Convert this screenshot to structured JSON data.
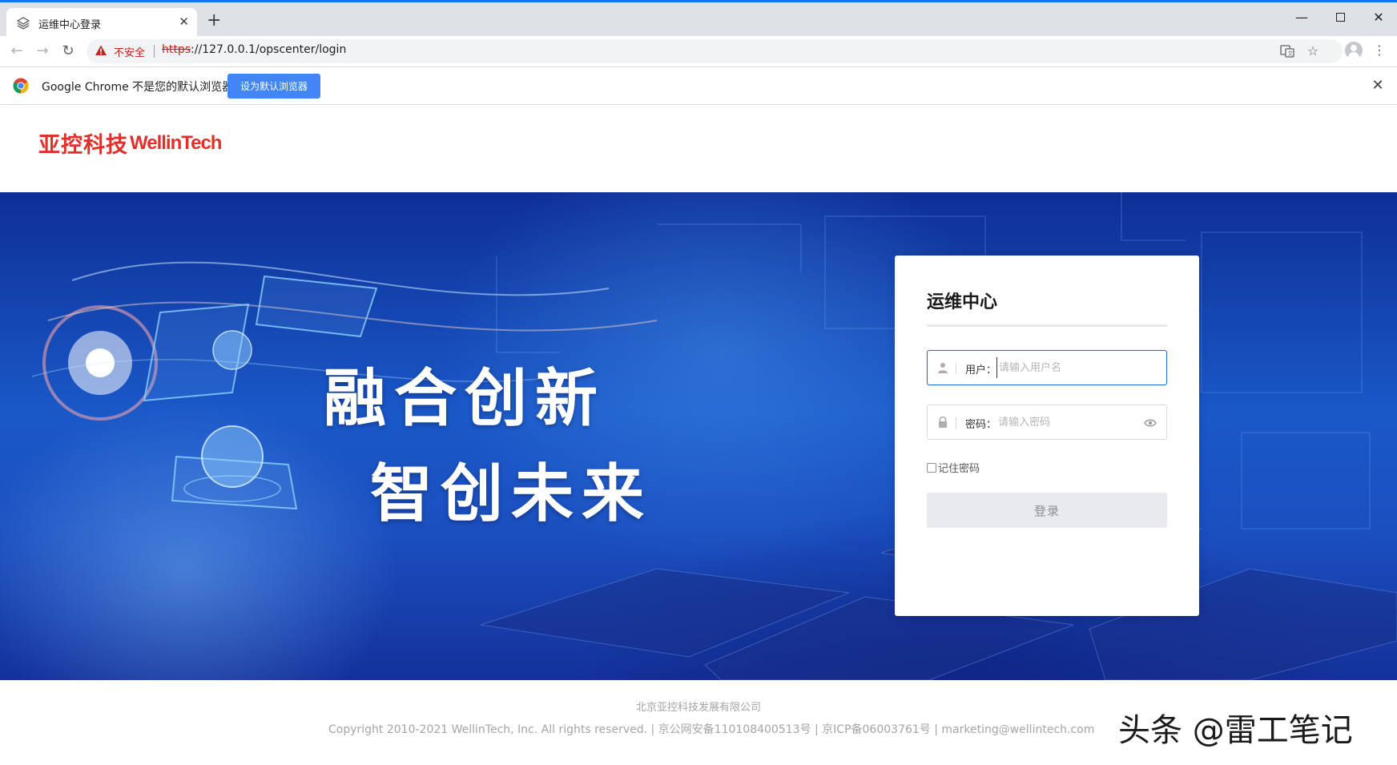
{
  "browser": {
    "tab_title": "运维中心登录",
    "tab_close": "✕",
    "new_tab": "+",
    "window_controls": {
      "minimize": "—",
      "close": "✕"
    },
    "security_label": "不安全",
    "url_scheme": "https",
    "url_rest": "://127.0.0.1/opscenter/login",
    "infobar_text": "Google Chrome 不是您的默认浏览器",
    "infobar_button": "设为默认浏览器",
    "infobar_close": "✕",
    "icons": [
      "layers-icon",
      "back-arrow-icon",
      "forward-arrow-icon",
      "reload-icon",
      "warning-icon",
      "translate-icon",
      "star-icon",
      "profile-icon",
      "menu-icon",
      "chrome-logo-icon"
    ]
  },
  "header": {
    "logo_cn": "亚控科技",
    "logo_en": "WellinTech",
    "logo_color": "#e22f2a"
  },
  "banner": {
    "slogan_line1": "融合创新",
    "slogan_line2": "智创未来"
  },
  "login": {
    "title": "运维中心",
    "username_label": "用户：",
    "username_placeholder": "请输入用户名",
    "password_label": "密码：",
    "password_placeholder": "请输入密码",
    "remember_label": "记住密码",
    "remember_checked": false,
    "submit_label": "登录",
    "accent_color": "#1e6fd9"
  },
  "footer": {
    "company": "北京亚控科技发展有限公司",
    "copyright": "Copyright 2010-2021 WellinTech, Inc. All rights reserved. | 京公网安备110108400513号 | 京ICP备06003761号 | marketing@wellintech.com",
    "watermark": "头条 @雷工笔记"
  }
}
